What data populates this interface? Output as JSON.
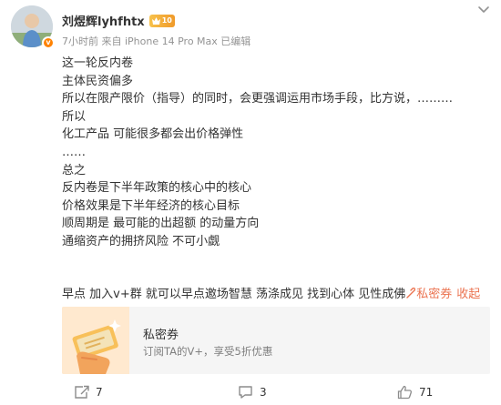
{
  "header": {
    "author_name": "刘煜辉lyhfhtx",
    "level_badge": "10",
    "verified_badge": "v",
    "meta_text": "7小时前  来自 iPhone 14 Pro Max  已编辑"
  },
  "post": {
    "lines": [
      "这一轮反内卷",
      "主体民资偏多",
      "所以在限产限价（指导）的同时，会更强调运用市场手段，比方说，………",
      "所以",
      "化工产品 可能很多都会出价格弹性",
      "……",
      "总之",
      "反内卷是下半年政策的核心中的核心",
      "价格效果是下半年经济的核心目标",
      "顺周期是 最可能的出超额 的动量方向",
      "通缩资产的拥挤风险 不可小觑"
    ],
    "cta_text": "早点 加入v+群 就可以早点邀场智慧 荡涤成见 找到心体 见性成佛",
    "coupon_link": "私密券",
    "collapse_label": "收起"
  },
  "card": {
    "title": "私密券",
    "subtitle": "订阅TA的V+，享受5折优惠"
  },
  "actions": {
    "repost_count": "7",
    "comment_count": "3",
    "like_count": "71"
  },
  "colors": {
    "link": "#eb7350",
    "meta": "#939393",
    "badge": "#f09a2a"
  }
}
